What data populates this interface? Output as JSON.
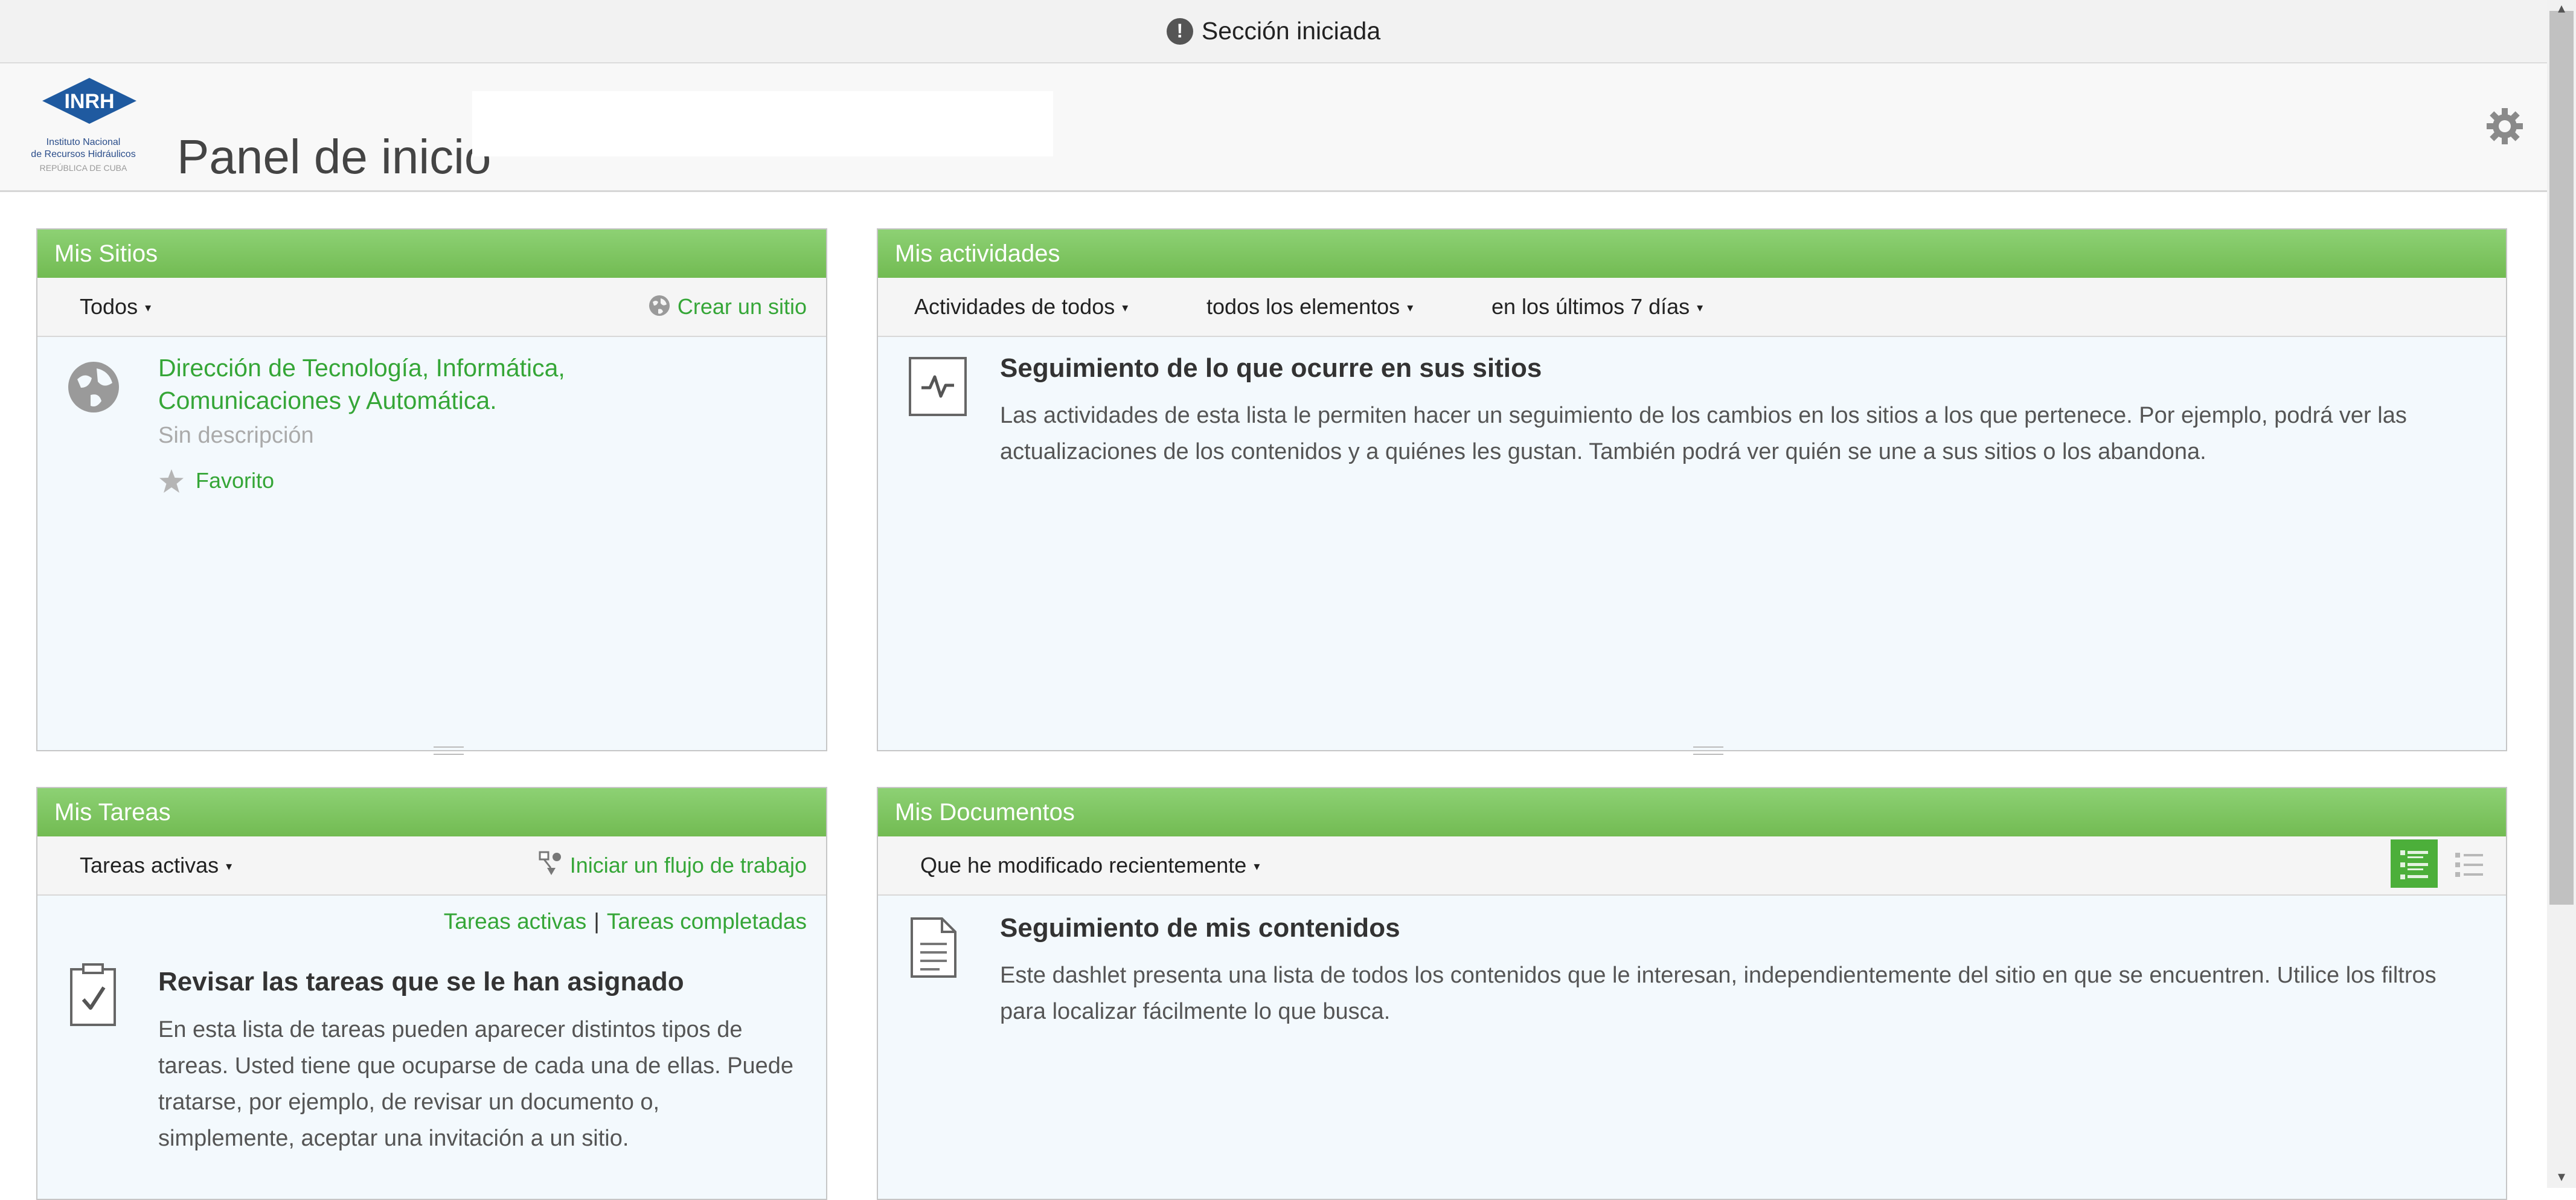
{
  "notice": {
    "text": "Sección iniciada"
  },
  "header": {
    "logo": {
      "abbr": "INRH",
      "line1": "Instituto Nacional",
      "line2": "de Recursos Hidráulicos",
      "line3": "REPÚBLICA DE CUBA"
    },
    "title": "Panel de inicio"
  },
  "dashlets": {
    "sitios": {
      "title": "Mis Sitios",
      "filter": "Todos",
      "create_link": "Crear un sitio",
      "sites": [
        {
          "name": "Dirección de Tecnología, Informática, Comunicaciones y Automática.",
          "description": "Sin descripción",
          "favorite_label": "Favorito"
        }
      ]
    },
    "actividades": {
      "title": "Mis actividades",
      "filter_who": "Actividades de todos",
      "filter_what": "todos los elementos",
      "filter_when": "en los últimos 7 días",
      "help_title": "Seguimiento de lo que ocurre en sus sitios",
      "help_text": "Las actividades de esta lista le permiten hacer un seguimiento de los cambios en los sitios a los que pertenece. Por ejemplo, podrá ver las actualizaciones de los contenidos y a quiénes les gustan. También podrá ver quién se une a sus sitios o los abandona."
    },
    "tareas": {
      "title": "Mis Tareas",
      "filter": "Tareas activas",
      "workflow_link": "Iniciar un flujo de trabajo",
      "link_active": "Tareas activas",
      "link_separator": "|",
      "link_completed": "Tareas completadas",
      "help_title": "Revisar las tareas que se le han asignado",
      "help_text": "En esta lista de tareas pueden aparecer distintos tipos de tareas. Usted tiene que ocuparse de cada una de ellas. Puede tratarse, por ejemplo, de revisar un documento o, simplemente, aceptar una invitación a un sitio."
    },
    "documentos": {
      "title": "Mis Documentos",
      "filter": "Que he modificado recientemente",
      "help_title": "Seguimiento de mis contenidos",
      "help_text": "Este dashlet presenta una lista de todos los contenidos que le interesan, independientemente del sitio en que se encuentren. Utilice los filtros para localizar fácilmente lo que busca."
    }
  },
  "colors": {
    "dashlet_header": "#7cc45d",
    "link_green": "#35a637",
    "body_bg": "#f3f9fd"
  },
  "icons": {
    "notice": "exclamation-circle-icon",
    "settings": "gear-icon",
    "site": "globe-icon",
    "favorite": "star-icon",
    "activity": "activity-pulse-icon",
    "task": "clipboard-check-icon",
    "document": "document-icon"
  }
}
